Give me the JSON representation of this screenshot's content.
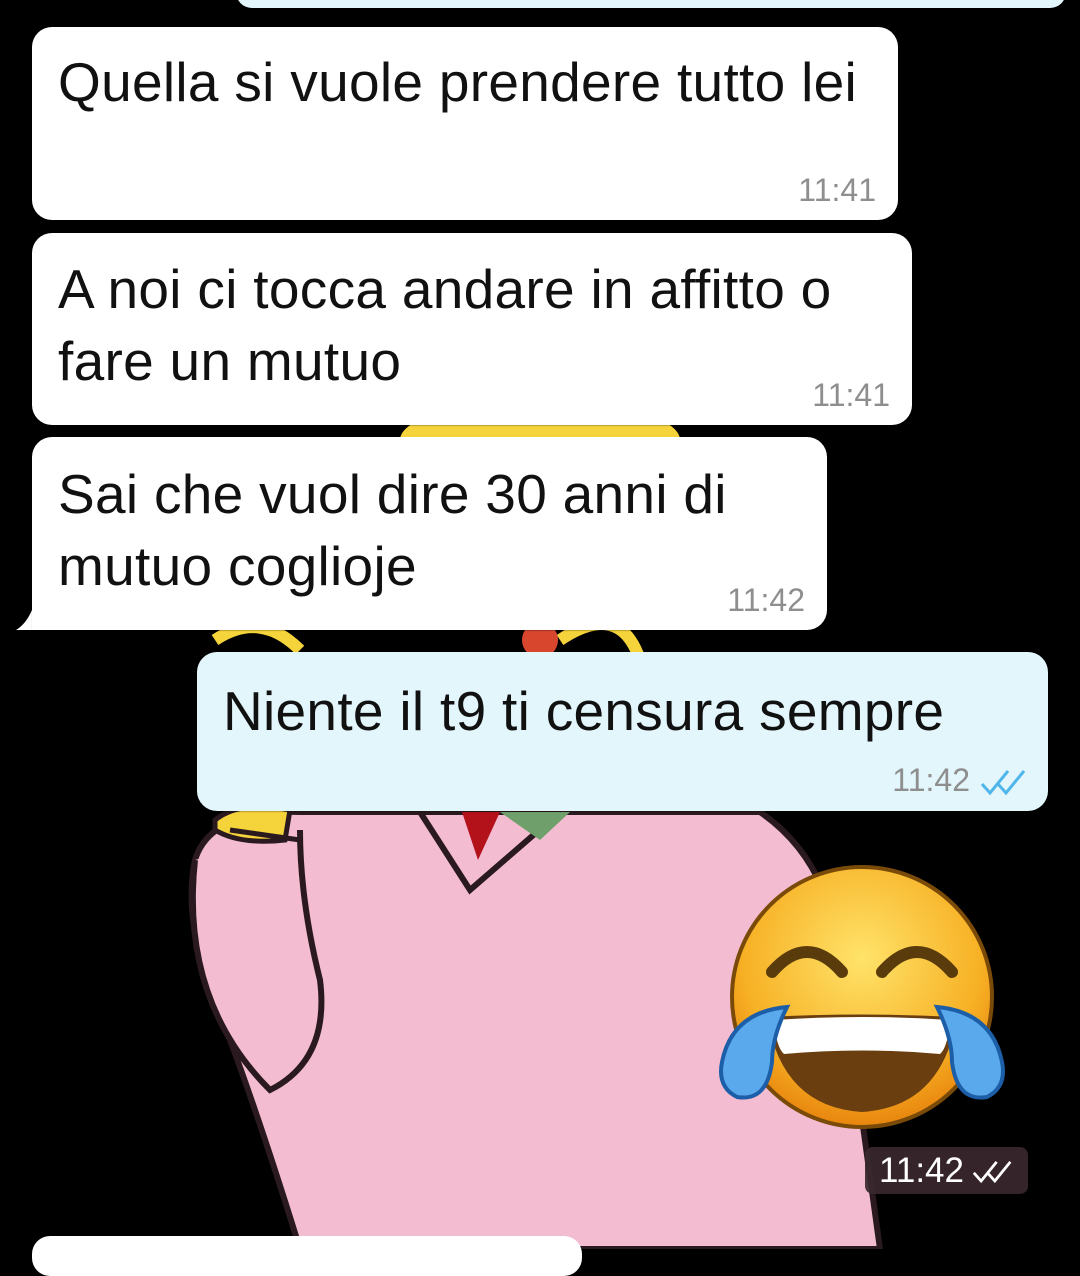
{
  "messages": [
    {
      "direction": "incoming",
      "text": "Quella si vuole prendere tutto lei",
      "time": "11:41"
    },
    {
      "direction": "incoming",
      "text": "A noi ci tocca andare in affitto o fare un mutuo",
      "time": "11:41"
    },
    {
      "direction": "incoming",
      "text": "Sai che vuol dire 30 anni di mutuo coglioje",
      "time": "11:42"
    },
    {
      "direction": "outgoing",
      "text": "Niente il t9 ti censura sempre",
      "time": "11:42",
      "status": "read"
    }
  ],
  "sticker": {
    "emoji": "😂",
    "icon": "face-with-tears-of-joy-icon",
    "time": "11:42",
    "status": "read"
  },
  "colors": {
    "incoming_bubble": "#ffffff",
    "outgoing_bubble": "#e2f6fb",
    "read_ticks": "#4fb6ec",
    "wallpaper": "#000000"
  }
}
